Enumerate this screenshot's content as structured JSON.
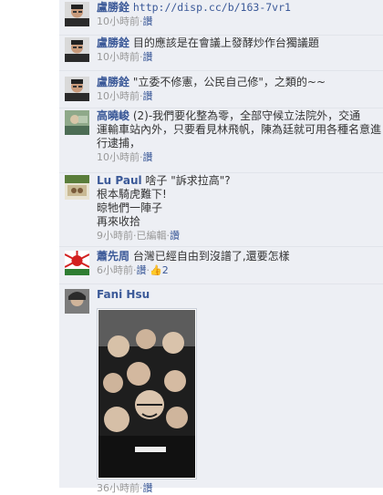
{
  "comments": [
    {
      "author": "盧勝銓",
      "text": "http://disp.cc/b/163-7vr1",
      "time": "10小時前",
      "like": "讚"
    },
    {
      "author": "盧勝銓",
      "text": "目的應該是在會議上發酵炒作台獨議題",
      "time": "10小時前",
      "like": "讚"
    },
    {
      "author": "盧勝銓",
      "text": "\"立委不修憲，公民自己修\"，之類的~~",
      "time": "10小時前",
      "like": "讚"
    },
    {
      "author": "高曉峻",
      "text_lines": [
        "(2)-我們要化整為零，全部守候立法院外，交通",
        "運輸車站內外，只要看見林飛帆，陳為廷就可用各種名意進",
        "行逮捕，"
      ],
      "time": "10小時前",
      "like": "讚"
    },
    {
      "author": "Lu Paul",
      "text_lines": [
        "啥子 \"訴求拉高\"?",
        "根本騎虎難下!",
        "晾牠們一陣子",
        "再來收拾"
      ],
      "time": "9小時前",
      "edited": "已編輯",
      "like": "讚"
    },
    {
      "author": "蕭先周",
      "text": "台灣已經自由到沒譜了,還要怎樣",
      "time": "6小時前",
      "like": "讚",
      "like_count": "2"
    },
    {
      "author": "Fani Hsu",
      "time": "36小時前",
      "like": "讚"
    }
  ],
  "colors": {
    "link": "#3b5998",
    "meta": "#999999",
    "panel": "#edeff4"
  },
  "icons": {
    "like_count": "thumbs-up-icon"
  }
}
